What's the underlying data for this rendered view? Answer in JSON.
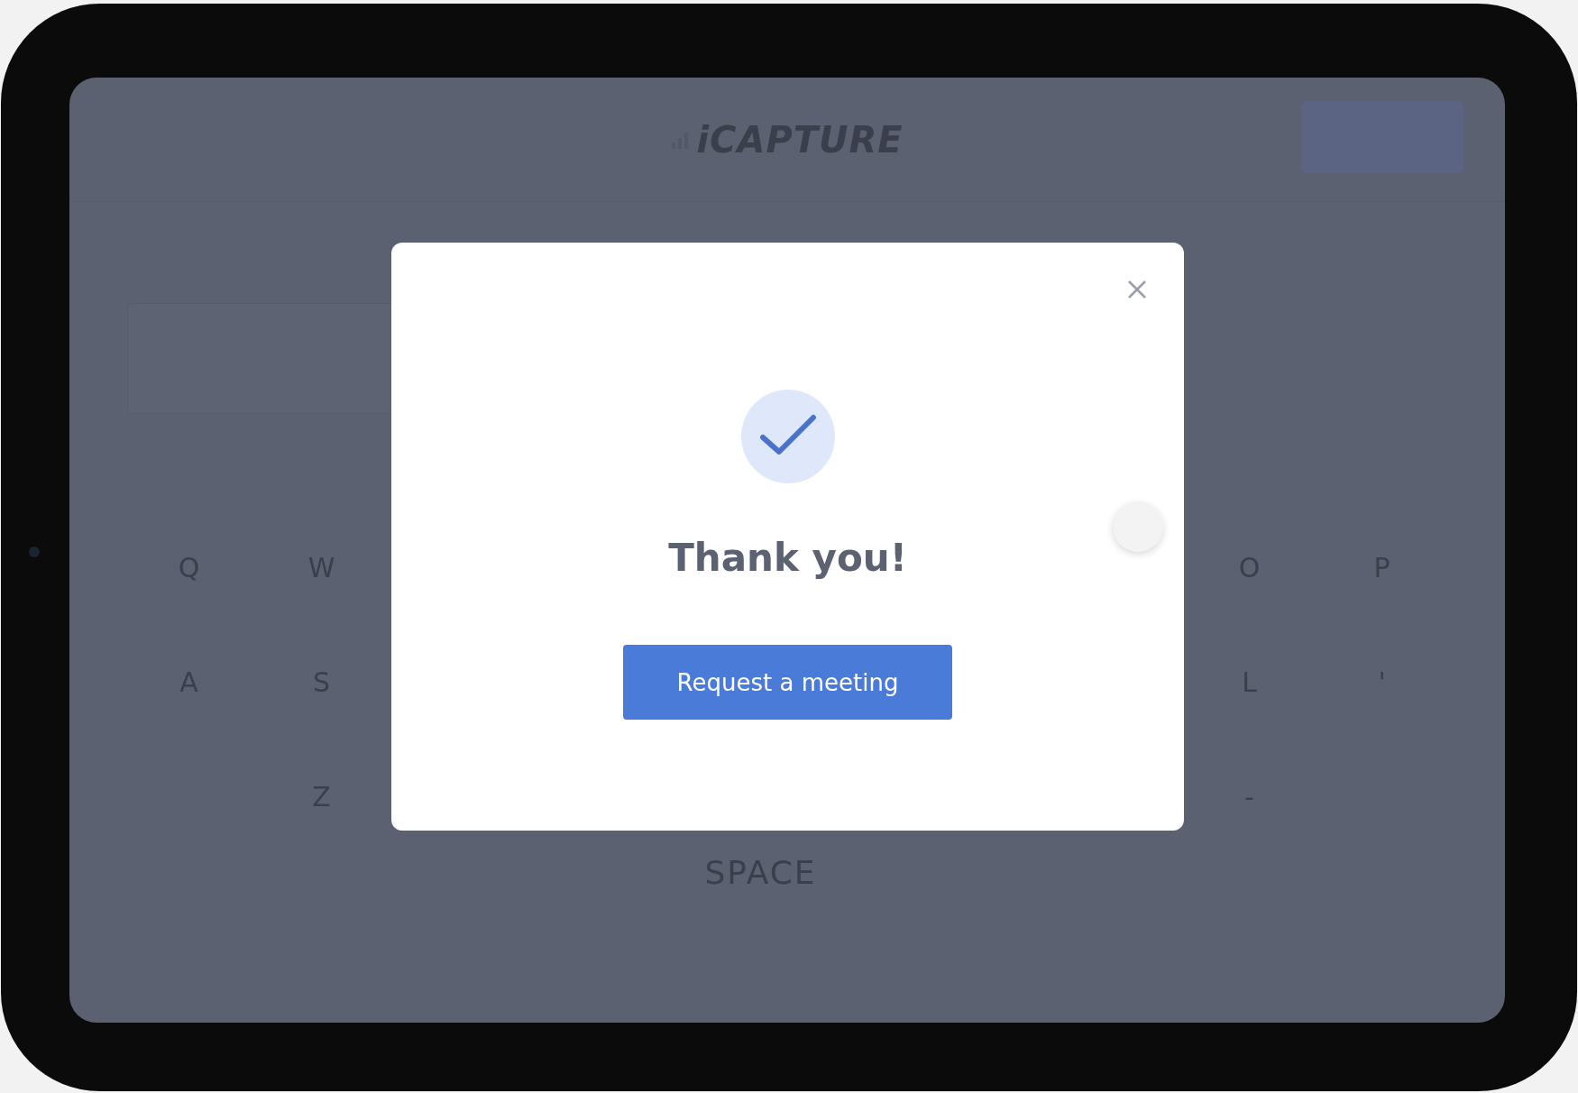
{
  "app": {
    "logo": "iCAPTURE"
  },
  "keyboard": {
    "rows": [
      {
        "left": [
          "Q",
          "W"
        ],
        "right": [
          "O",
          "P"
        ]
      },
      {
        "left": [
          "A",
          "S"
        ],
        "right": [
          "L",
          "'"
        ]
      },
      {
        "left": [
          "Z"
        ],
        "right": [
          "-"
        ]
      }
    ],
    "space": "SPACE"
  },
  "dialog": {
    "title": "Thank you!",
    "button": "Request a meeting"
  }
}
